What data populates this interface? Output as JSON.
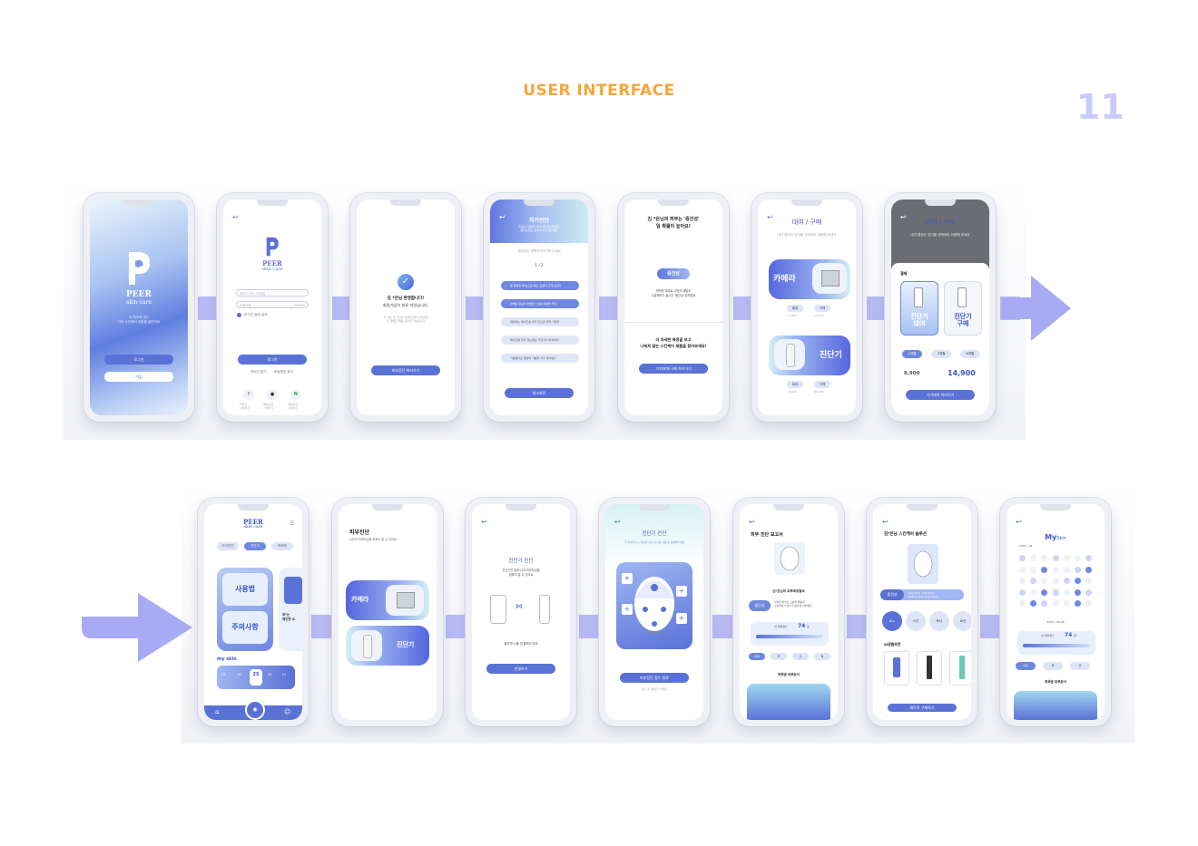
{
  "header": {
    "title": "USER INTERFACE",
    "page_number": "11"
  },
  "row1": {
    "splash": {
      "brand": "PEER",
      "sub": "skin care",
      "tagline": "내 피부에 맞는\n더욱 스킨케어 제품을 골라줘요",
      "login": "로그인",
      "join": "가입"
    },
    "login": {
      "brand": "PEER",
      "sub": "skin care",
      "id_placeholder": "아이디 또는 이메일",
      "pw_placeholder": "비밀번호",
      "pw_hint": "SHOW",
      "auto": "로그인 상태 유지",
      "login_btn": "로그인",
      "find_id": "아이디 찾기",
      "find_pw": "비밀번호 찾기",
      "sns": [
        "f",
        "●",
        "N"
      ],
      "sns_labels": [
        "카카오\n시작하기",
        "페이스북\n시작하기",
        "네이버로\n시작하기"
      ]
    },
    "welcome": {
      "line1": "김 *은님 환영합니다!",
      "line2": "회원가입이 완료 되었습니다.",
      "desc": "첫 이용 전 간단한 피부진단을 진행하면\n더 정확한 제품 추천이 가능합니다",
      "btn": "피부진단 하러가기"
    },
    "self_check": {
      "title": "자가진단",
      "desc": "다음의 질문에 답하시면 피부타입을\n알려드려요. 솔직하게 답해주세요",
      "sub": "해당되는 항목에 체크 해 주세요",
      "page": "1 / 2",
      "items": [
        "맨 얼굴일 때 눈으로 봐도 모공이 크게 보인다",
        "번쩍번 코보다 번쩍한 느낌의 화장이 좋다",
        "화장하는 메이크를 잡지 않으면 곧잘 가렵다",
        "메이크를 자주 건는대도 거칠거나 버석하다",
        "기름종이로 얼굴에 기름을 자주 닦아낸다"
      ],
      "btn": "체크완료"
    },
    "result": {
      "line1": "김 *은님의 피부는 '중건성'",
      "line2": "일 확률이 높아요!",
      "badge": "중건성",
      "desc": "적적한 피부로 고민의 때팅과\n수분케어가 필수인 '중건성' 피부예요",
      "line3": "더 자세한 측정을 보고",
      "line4": "나에게 맞는 스킨케어 제품을 찾아보세요!",
      "btn": "기기대여/구매 하러가기"
    },
    "rent1": {
      "title": "대여 / 구매",
      "sub": "내가 원하는 방식을 선택하여 이용해 보세요",
      "cam": "카메라",
      "diag": "진단기",
      "rent": "대여",
      "buy": "구매",
      "price1a": "1,900",
      "price1b": "13,000",
      "price2a": "8,900",
      "price2b": "89,000"
    },
    "rent2": {
      "title": "대여 / 구매",
      "sub": "내가 원하는 방식을 선택하여 이용해 보세요",
      "sheet_title": "결제",
      "opt1": "진단기\n대여",
      "opt2": "진단기\n구매",
      "durations": [
        "1개월",
        "3개월",
        "6개월"
      ],
      "price_old": "8,900",
      "price_new": "14,900",
      "btn": "기기대여 하러가기"
    }
  },
  "row2": {
    "home": {
      "brand": "PEER",
      "sub": "skin care",
      "tabs": [
        "자가진단",
        "진단기",
        "카메라"
      ],
      "card1": "사용법",
      "card2": "주의사항",
      "side_text": "최*는\n예민한 수",
      "section": "my skin",
      "dates": [
        "23",
        "24",
        "25",
        "26",
        "27"
      ]
    },
    "skin_diag": {
      "title": "피부진단",
      "sub": "나만의 피부타입을 정확히 알 수 있어요.",
      "cam": "카메라",
      "diag": "진단기"
    },
    "device": {
      "title": "진단기 진단",
      "desc": "진단기를 통해 나의 피부타입을\n정확히 알 수 있어요",
      "hint": "블루투스를 연결해주세요",
      "btn": "연결하기"
    },
    "face": {
      "title": "진단기 진단",
      "desc": "두 피부톤과 + 부분을 눌러 기기를 사용 후 측정해주세요",
      "btn": "피부진단 접수 완료",
      "sub": "잠시 후 결과가 나와요"
    },
    "report": {
      "title": "피부 진단 보고서",
      "name": "김*은님의 피부측정결과",
      "badge": "중건성",
      "desc": "적적한 피부로 고민의 때팅과\n수분케어가 필수인 중건성 피부예요",
      "score_label": "내 피부점수",
      "score": "74",
      "unit": "점",
      "chips": [
        "이마",
        "볼",
        "코",
        "턱"
      ],
      "section": "항목별 피부분석"
    },
    "solution": {
      "title": "김*은님 스킨케어 솔루션",
      "badge": "중건성",
      "desc": "적적한 피부로 고민의 때팅과\n수분케어가 필수인 중건성 피부예요",
      "cats": [
        "ALL",
        "스킨",
        "토너",
        "로션"
      ],
      "section": "AI맞춤추천",
      "btn": "세트로 구매하기"
    },
    "myskin": {
      "title_a": "My",
      "title_b": "Skin",
      "month": "2024 - 05",
      "date": "2024 - 05.06",
      "score_label": "내 피부점수",
      "score": "74",
      "unit": "점",
      "chips": [
        "이마",
        "볼",
        "코"
      ],
      "section": "항목별 피부분석"
    }
  },
  "colors": {
    "accent": "#5a72d6",
    "title_orange": "#f6a53a",
    "page_num": "#c9ccfb",
    "connector": "#b9bbf5",
    "arrow": "#a8abf3"
  }
}
